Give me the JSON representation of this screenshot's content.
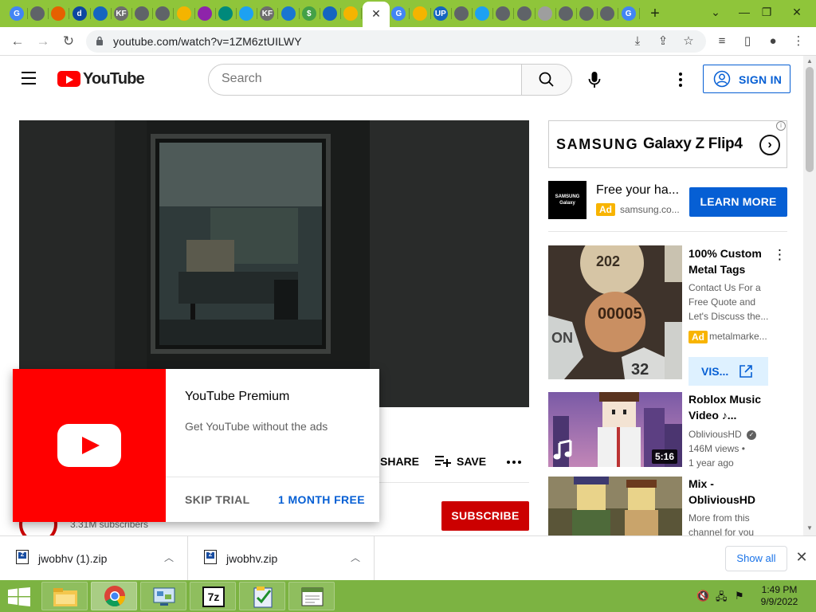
{
  "browser": {
    "url": "youtube.com/watch?v=1ZM6ztUILWY",
    "tab_close_glyph": "✕",
    "new_tab_glyph": "+",
    "tab_favicons": [
      {
        "icon": "google-icon",
        "color": "#4285f4",
        "letter": "G"
      },
      {
        "icon": "globe-icon",
        "color": "#5f6368",
        "letter": ""
      },
      {
        "icon": "firefox-icon",
        "color": "#e66000",
        "letter": ""
      },
      {
        "icon": "d-icon",
        "color": "#0d47a1",
        "letter": "d"
      },
      {
        "icon": "home-icon",
        "color": "#1565c0",
        "letter": ""
      },
      {
        "icon": "kf-icon",
        "color": "#6d6d6d",
        "letter": "KF"
      },
      {
        "icon": "globe-icon",
        "color": "#5f6368",
        "letter": ""
      },
      {
        "icon": "globe-icon",
        "color": "#5f6368",
        "letter": ""
      },
      {
        "icon": "bookmark-icon",
        "color": "#f4b400",
        "letter": ""
      },
      {
        "icon": "chevron-icon",
        "color": "#8e24aa",
        "letter": ""
      },
      {
        "icon": "feather-icon",
        "color": "#00897b",
        "letter": ""
      },
      {
        "icon": "twitter-icon",
        "color": "#1da1f2",
        "letter": ""
      },
      {
        "icon": "kf-icon",
        "color": "#6d6d6d",
        "letter": "KF"
      },
      {
        "icon": "arrow-icon",
        "color": "#1976d2",
        "letter": ""
      },
      {
        "icon": "dollar-icon",
        "color": "#43a047",
        "letter": "$"
      },
      {
        "icon": "home-icon",
        "color": "#1565c0",
        "letter": ""
      },
      {
        "icon": "note-icon",
        "color": "#f4b400",
        "letter": ""
      },
      {
        "icon": "google-icon",
        "color": "#4285f4",
        "letter": "G"
      },
      {
        "icon": "note-icon",
        "color": "#f4b400",
        "letter": ""
      },
      {
        "icon": "up-icon",
        "color": "#1565c0",
        "letter": "UP"
      },
      {
        "icon": "globe-icon",
        "color": "#5f6368",
        "letter": ""
      },
      {
        "icon": "twitter-icon",
        "color": "#1da1f2",
        "letter": ""
      },
      {
        "icon": "globe-icon",
        "color": "#5f6368",
        "letter": ""
      },
      {
        "icon": "globe-icon",
        "color": "#5f6368",
        "letter": ""
      },
      {
        "icon": "globe-icon",
        "color": "#9e9e9e",
        "letter": ""
      },
      {
        "icon": "globe-icon",
        "color": "#5f6368",
        "letter": ""
      },
      {
        "icon": "globe-icon",
        "color": "#5f6368",
        "letter": ""
      },
      {
        "icon": "globe-icon",
        "color": "#5f6368",
        "letter": ""
      },
      {
        "icon": "google-icon",
        "color": "#4285f4",
        "letter": "G"
      }
    ],
    "colors": {
      "frame": "#8fc53a",
      "accent": "#065fd4",
      "yt_red": "#ff0000"
    }
  },
  "youtube": {
    "logo_text": "YouTube",
    "search_placeholder": "Search",
    "sign_in_label": "SIGN IN",
    "share_label": "SHARE",
    "save_label": "SAVE",
    "subscribers": "3.31M subscribers",
    "subscribe_label": "SUBSCRIBE",
    "ad_banner": {
      "brand": "SAMSUNG",
      "model": "Galaxy Z Flip4",
      "arrow": "›",
      "info": "i"
    },
    "ad_unit": {
      "logo_text": "SAMSUNG Galaxy",
      "title": "Free your ha...",
      "badge": "Ad",
      "domain": "samsung.co...",
      "cta": "LEARN MORE"
    },
    "recommendations": [
      {
        "title": "100% Custom Metal Tags",
        "description": "Contact Us For a Free Quote and Let's Discuss the...",
        "badge": "Ad",
        "domain": "metalmarke...",
        "cta": "VIS..."
      },
      {
        "title": "Roblox Music Video ♪...",
        "channel": "ObliviousHD",
        "views": "146M views •",
        "age": "1 year ago",
        "duration": "5:16"
      },
      {
        "title": "Mix - ObliviousHD",
        "description": "More from this channel for you"
      }
    ],
    "premium_popup": {
      "title": "YouTube Premium",
      "subtitle": "Get YouTube without the ads",
      "skip": "SKIP TRIAL",
      "offer": "1 MONTH FREE"
    }
  },
  "downloads": {
    "items": [
      {
        "name": "jwobhv (1).zip"
      },
      {
        "name": "jwobhv.zip"
      }
    ],
    "show_all": "Show all"
  },
  "taskbar": {
    "time": "1:49 PM",
    "date": "9/9/2022"
  }
}
